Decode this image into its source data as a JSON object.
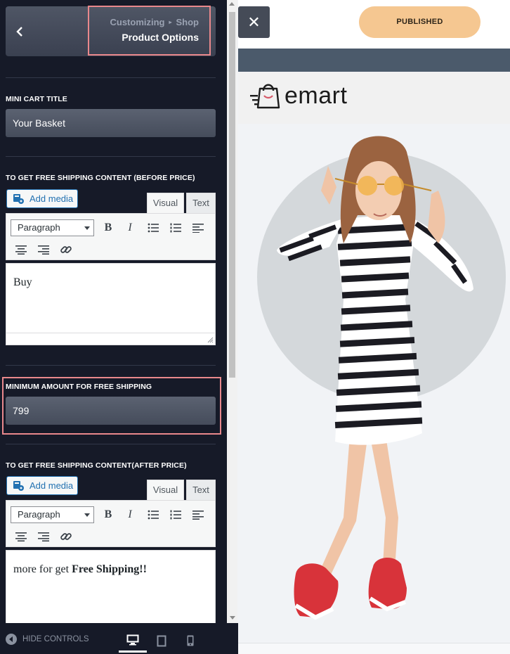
{
  "header": {
    "breadcrumb_parent": "Customizing",
    "breadcrumb_sep": "▸",
    "breadcrumb_current": "Shop",
    "title": "Product Options"
  },
  "mini_cart": {
    "label": "MINI CART TITLE",
    "value": "Your Basket"
  },
  "before_price": {
    "label": "TO GET FREE SHIPPING CONTENT (BEFORE PRICE)",
    "add_media": "Add media",
    "tab_visual": "Visual",
    "tab_text": "Text",
    "format": "Paragraph",
    "content": "Buy"
  },
  "min_amount": {
    "label": "MINIMUM AMOUNT FOR FREE SHIPPING",
    "value": "799"
  },
  "after_price": {
    "label": "TO GET FREE SHIPPING CONTENT(AFTER PRICE)",
    "add_media": "Add media",
    "tab_visual": "Visual",
    "tab_text": "Text",
    "format": "Paragraph",
    "content_prefix": "more for get ",
    "content_bold": "Free Shipping!!"
  },
  "footer": {
    "hide_controls": "HIDE CONTROLS",
    "devices": [
      "desktop",
      "tablet",
      "mobile"
    ],
    "active_device": "desktop"
  },
  "preview": {
    "close": "✕",
    "publish": "PUBLISHED",
    "logo": "emart"
  },
  "colors": {
    "panel": "#161a28",
    "highlight": "#e9888c",
    "publish": "#f5c791",
    "link": "#2271b1"
  }
}
